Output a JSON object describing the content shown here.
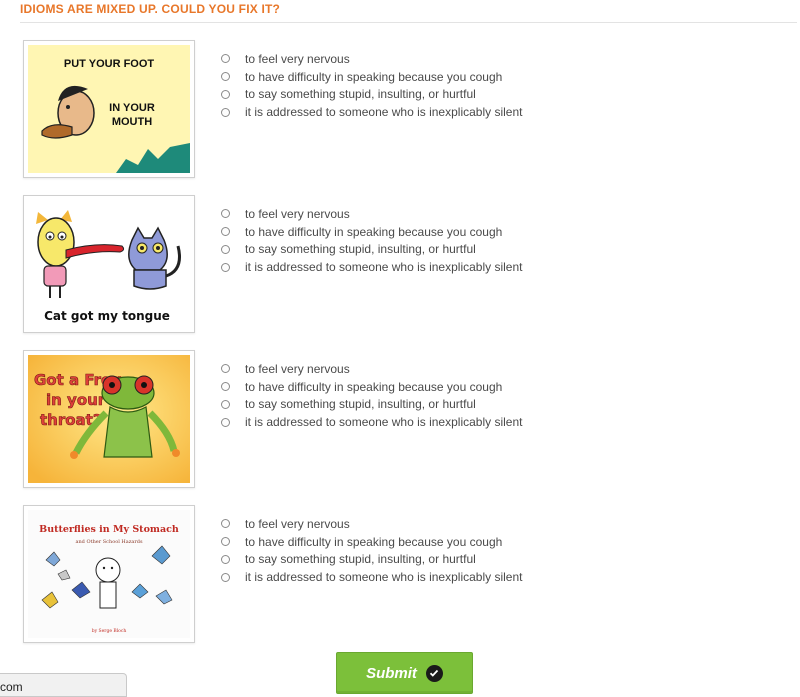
{
  "quiz": {
    "title": "IDIOMS ARE MIXED UP. COULD YOU FIX IT?",
    "options": [
      "to feel very nervous",
      "to have difficulty in speaking because you cough",
      "to say something stupid, insulting, or hurtful",
      "it is addressed to someone who is inexplicably silent"
    ],
    "questions": [
      {
        "image_text": [
          "PUT YOUR FOOT",
          "IN YOUR",
          "MOUTH"
        ]
      },
      {
        "image_text": [
          "Cat got my tongue"
        ]
      },
      {
        "image_text": [
          "Got a Frog",
          "in your",
          "throat?"
        ]
      },
      {
        "image_text": [
          "Butterflies in My Stomach",
          "and Other School Hazards",
          "by Serge Bloch"
        ]
      }
    ]
  },
  "submit": {
    "label": "Submit"
  },
  "status_bar": {
    "text": "com"
  },
  "colors": {
    "title": "#e8772a",
    "submit_bg": "#7cc03a"
  }
}
